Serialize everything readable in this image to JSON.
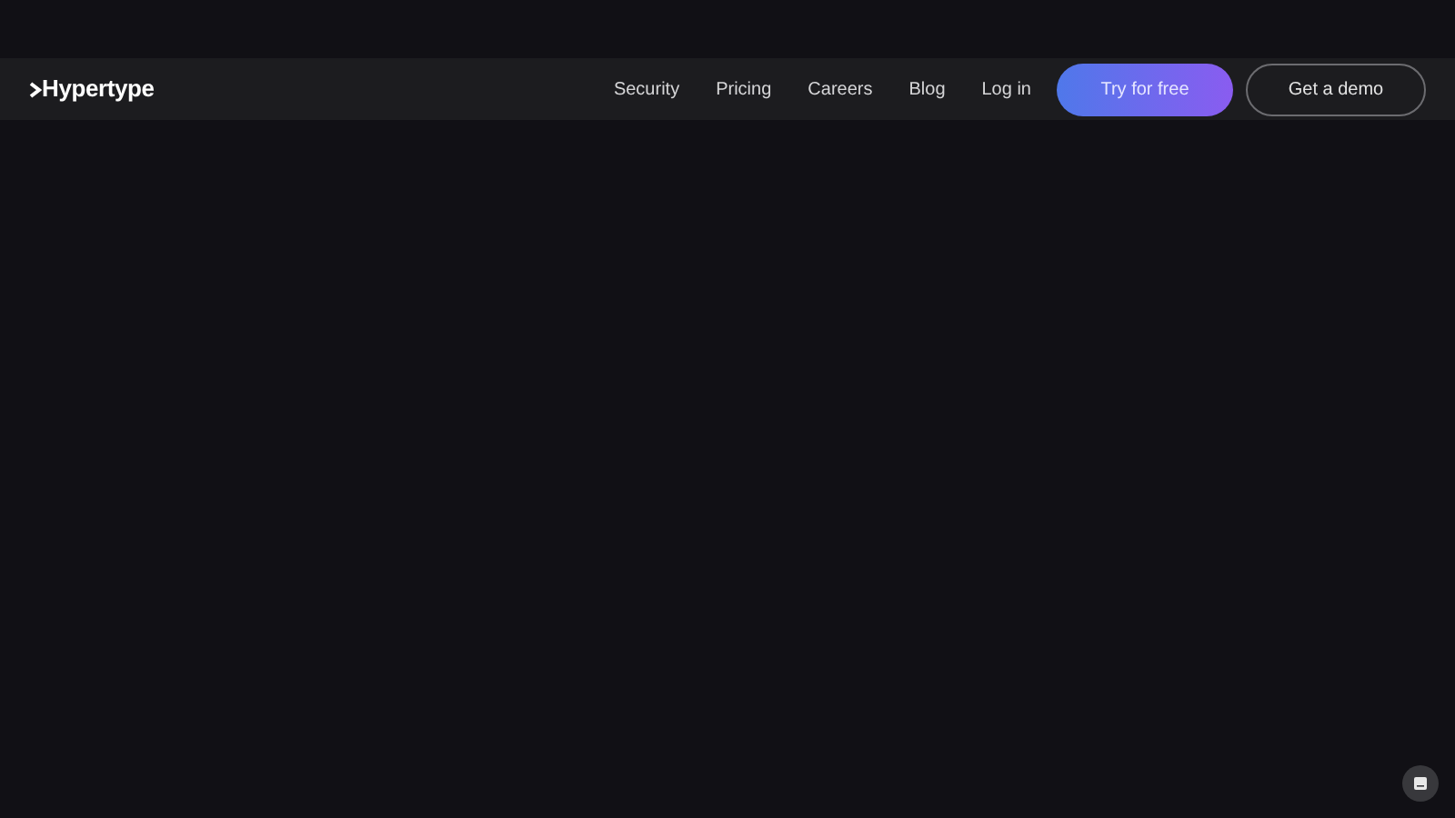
{
  "logo": {
    "text": "Hypertype"
  },
  "nav_links": [
    "Security",
    "Pricing",
    "Careers",
    "Blog",
    "Log in"
  ],
  "buttons": [
    {
      "label": "Try for free",
      "kind": "primary"
    },
    {
      "label": "Get a demo",
      "kind": "outline"
    }
  ]
}
